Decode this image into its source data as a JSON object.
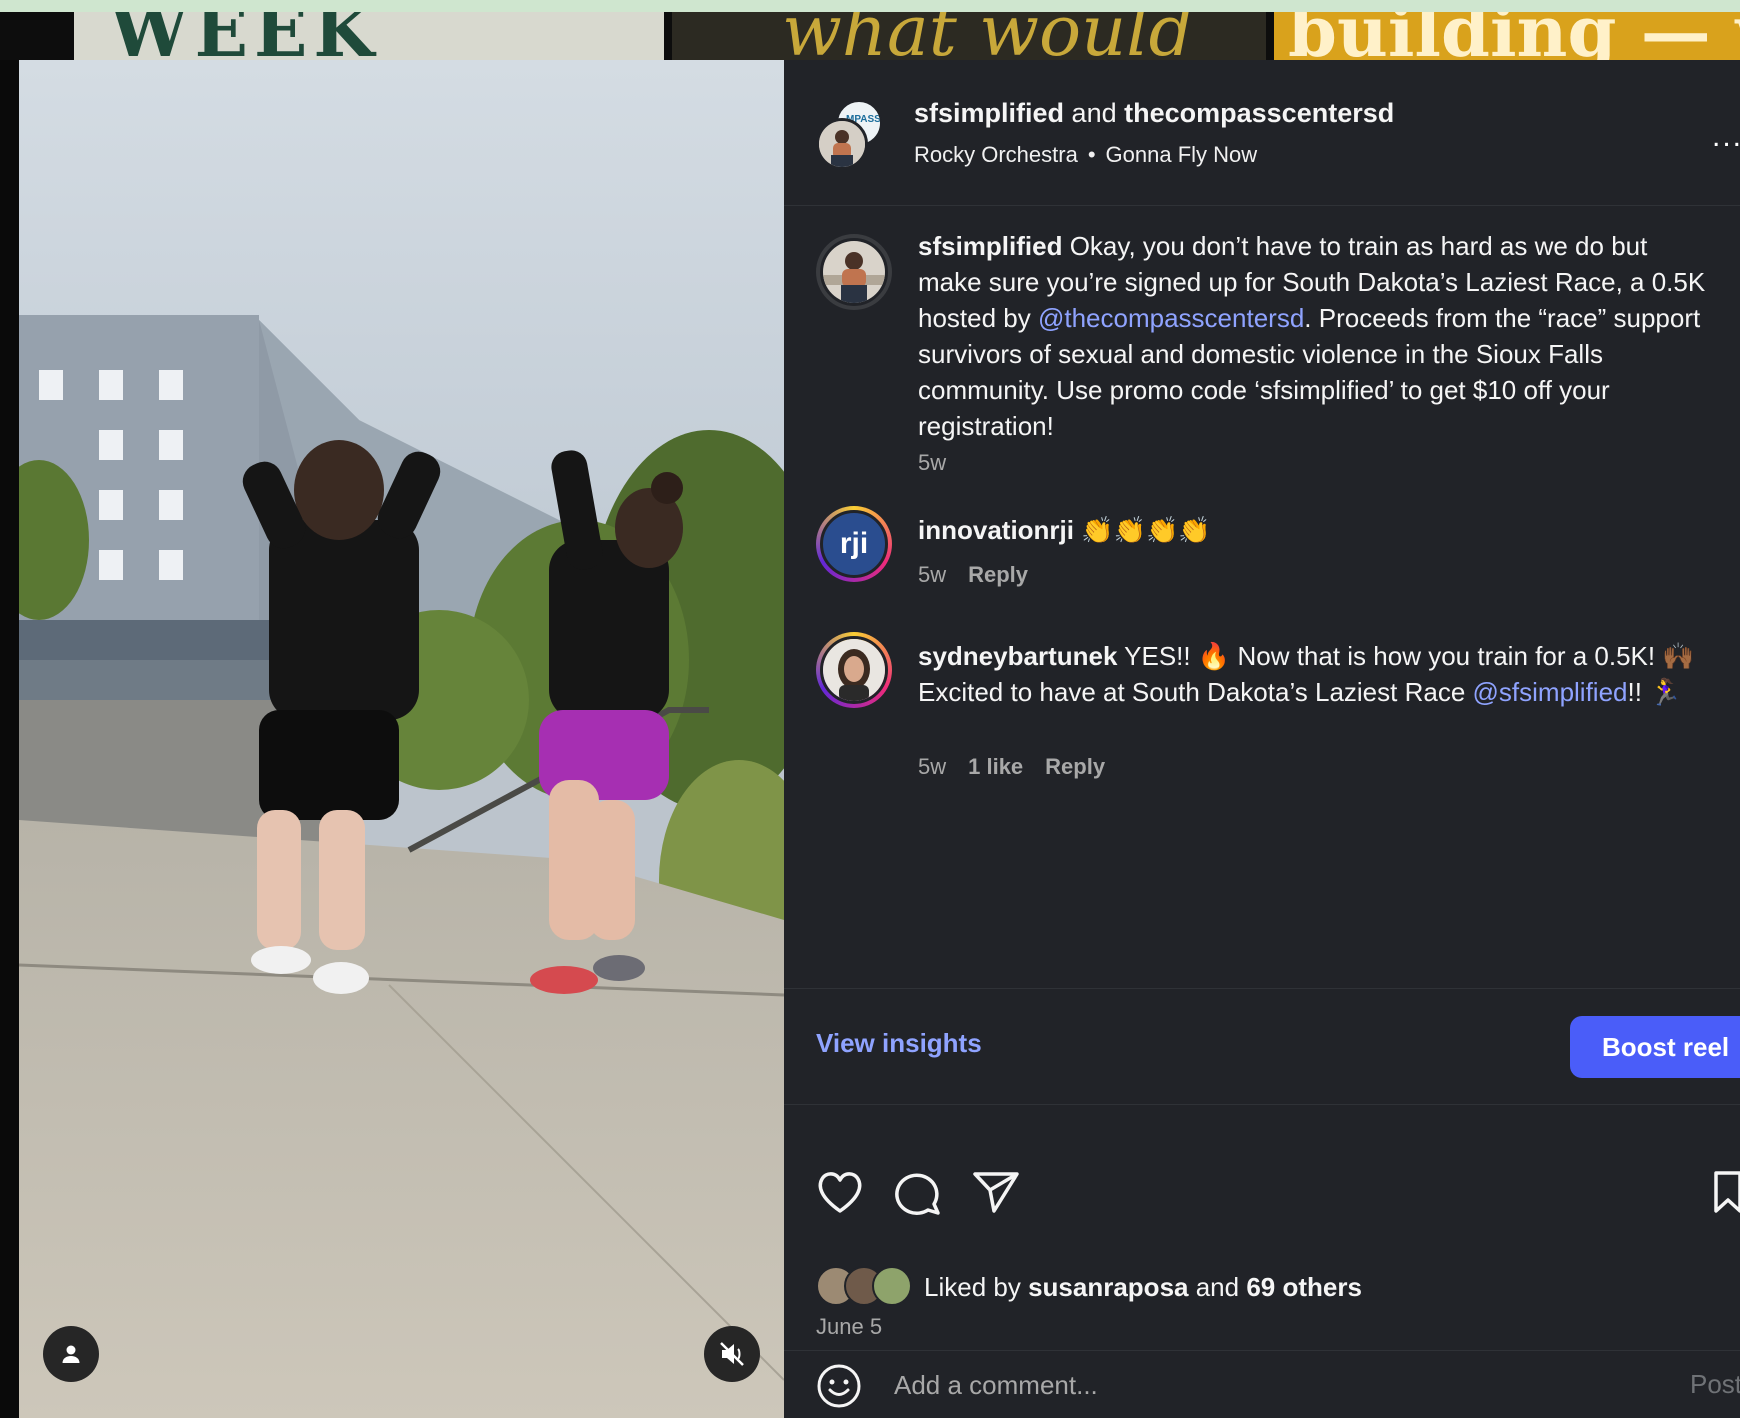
{
  "background": {
    "thumb1_text": "WEEK",
    "thumb2_text": "what would",
    "thumb3_text": "building — w"
  },
  "header": {
    "user1": "sfsimplified",
    "joiner": "and",
    "user2": "thecompasscentersd",
    "music_artist": "Rocky Orchestra",
    "music_separator": "•",
    "music_title": "Gonna Fly Now",
    "more_label": "..."
  },
  "caption": {
    "username": "sfsimplified",
    "text_1": " Okay, you don’t have to train as hard as we do but make sure you’re signed up for South Dakota’s Laziest Race, a 0.5K hosted by ",
    "mention": "@thecompasscentersd",
    "text_2": ". Proceeds from the “race” support survivors of sexual and domestic violence in the Sioux Falls community. Use promo code ‘sfsimplified’ to get $10 off your registration!",
    "time": "5w"
  },
  "comments": [
    {
      "username": "innovationrji",
      "avatar_text": "rji",
      "text": " 👏👏👏👏",
      "time": "5w",
      "reply": "Reply"
    },
    {
      "username": "sydneybartunek",
      "text_1": " YES!! 🔥 Now that is how you train for a 0.5K! 🙌🏾 Excited to have at South Dakota’s Laziest Race ",
      "mention": "@sfsimplified",
      "text_2": "!! 🏃‍♀️",
      "time": "5w",
      "likes": "1 like",
      "reply": "Reply"
    }
  ],
  "insights": {
    "view_label": "View insights",
    "boost_label": "Boost reel"
  },
  "likes": {
    "prefix": "Liked by ",
    "user": "susanraposa",
    "middle": " and ",
    "others": "69 others",
    "date": "June 5"
  },
  "add_comment": {
    "placeholder": "Add a comment...",
    "post_label": "Post"
  },
  "colors": {
    "accent": "#4a5df9",
    "link": "#8fa3ff",
    "panel": "#212328"
  }
}
